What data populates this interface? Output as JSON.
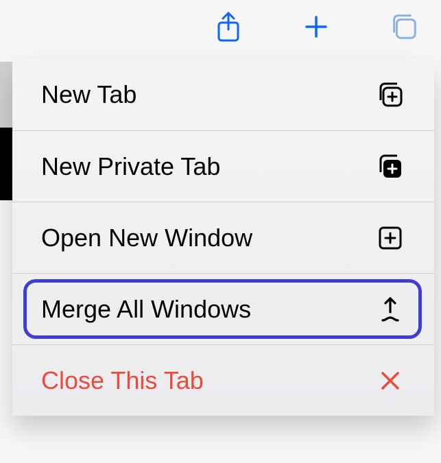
{
  "toolbar": {
    "share_icon": "share-icon",
    "plus_icon": "plus-icon",
    "tabs_icon": "tabs-icon"
  },
  "menu": {
    "items": [
      {
        "label": "New Tab",
        "icon": "new-tab-icon",
        "destructive": false
      },
      {
        "label": "New Private Tab",
        "icon": "new-private-tab-icon",
        "destructive": false
      },
      {
        "label": "Open New Window",
        "icon": "new-window-icon",
        "destructive": false
      },
      {
        "label": "Merge All Windows",
        "icon": "merge-icon",
        "destructive": false,
        "highlighted": true
      },
      {
        "label": "Close This Tab",
        "icon": "close-icon",
        "destructive": true
      }
    ]
  }
}
